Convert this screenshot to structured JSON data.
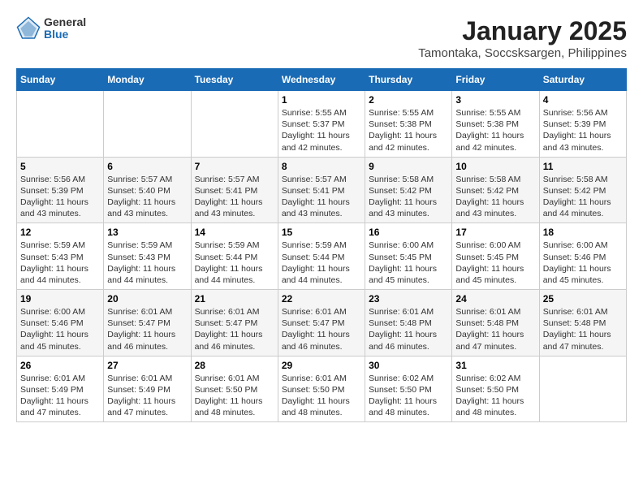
{
  "logo": {
    "general": "General",
    "blue": "Blue"
  },
  "title": "January 2025",
  "subtitle": "Tamontaka, Soccsksargen, Philippines",
  "days_of_week": [
    "Sunday",
    "Monday",
    "Tuesday",
    "Wednesday",
    "Thursday",
    "Friday",
    "Saturday"
  ],
  "weeks": [
    [
      {
        "day": "",
        "info": ""
      },
      {
        "day": "",
        "info": ""
      },
      {
        "day": "",
        "info": ""
      },
      {
        "day": "1",
        "sunrise": "5:55 AM",
        "sunset": "5:37 PM",
        "daylight": "11 hours and 42 minutes."
      },
      {
        "day": "2",
        "sunrise": "5:55 AM",
        "sunset": "5:38 PM",
        "daylight": "11 hours and 42 minutes."
      },
      {
        "day": "3",
        "sunrise": "5:55 AM",
        "sunset": "5:38 PM",
        "daylight": "11 hours and 42 minutes."
      },
      {
        "day": "4",
        "sunrise": "5:56 AM",
        "sunset": "5:39 PM",
        "daylight": "11 hours and 43 minutes."
      }
    ],
    [
      {
        "day": "5",
        "sunrise": "5:56 AM",
        "sunset": "5:39 PM",
        "daylight": "11 hours and 43 minutes."
      },
      {
        "day": "6",
        "sunrise": "5:57 AM",
        "sunset": "5:40 PM",
        "daylight": "11 hours and 43 minutes."
      },
      {
        "day": "7",
        "sunrise": "5:57 AM",
        "sunset": "5:41 PM",
        "daylight": "11 hours and 43 minutes."
      },
      {
        "day": "8",
        "sunrise": "5:57 AM",
        "sunset": "5:41 PM",
        "daylight": "11 hours and 43 minutes."
      },
      {
        "day": "9",
        "sunrise": "5:58 AM",
        "sunset": "5:42 PM",
        "daylight": "11 hours and 43 minutes."
      },
      {
        "day": "10",
        "sunrise": "5:58 AM",
        "sunset": "5:42 PM",
        "daylight": "11 hours and 43 minutes."
      },
      {
        "day": "11",
        "sunrise": "5:58 AM",
        "sunset": "5:42 PM",
        "daylight": "11 hours and 44 minutes."
      }
    ],
    [
      {
        "day": "12",
        "sunrise": "5:59 AM",
        "sunset": "5:43 PM",
        "daylight": "11 hours and 44 minutes."
      },
      {
        "day": "13",
        "sunrise": "5:59 AM",
        "sunset": "5:43 PM",
        "daylight": "11 hours and 44 minutes."
      },
      {
        "day": "14",
        "sunrise": "5:59 AM",
        "sunset": "5:44 PM",
        "daylight": "11 hours and 44 minutes."
      },
      {
        "day": "15",
        "sunrise": "5:59 AM",
        "sunset": "5:44 PM",
        "daylight": "11 hours and 44 minutes."
      },
      {
        "day": "16",
        "sunrise": "6:00 AM",
        "sunset": "5:45 PM",
        "daylight": "11 hours and 45 minutes."
      },
      {
        "day": "17",
        "sunrise": "6:00 AM",
        "sunset": "5:45 PM",
        "daylight": "11 hours and 45 minutes."
      },
      {
        "day": "18",
        "sunrise": "6:00 AM",
        "sunset": "5:46 PM",
        "daylight": "11 hours and 45 minutes."
      }
    ],
    [
      {
        "day": "19",
        "sunrise": "6:00 AM",
        "sunset": "5:46 PM",
        "daylight": "11 hours and 45 minutes."
      },
      {
        "day": "20",
        "sunrise": "6:01 AM",
        "sunset": "5:47 PM",
        "daylight": "11 hours and 46 minutes."
      },
      {
        "day": "21",
        "sunrise": "6:01 AM",
        "sunset": "5:47 PM",
        "daylight": "11 hours and 46 minutes."
      },
      {
        "day": "22",
        "sunrise": "6:01 AM",
        "sunset": "5:47 PM",
        "daylight": "11 hours and 46 minutes."
      },
      {
        "day": "23",
        "sunrise": "6:01 AM",
        "sunset": "5:48 PM",
        "daylight": "11 hours and 46 minutes."
      },
      {
        "day": "24",
        "sunrise": "6:01 AM",
        "sunset": "5:48 PM",
        "daylight": "11 hours and 47 minutes."
      },
      {
        "day": "25",
        "sunrise": "6:01 AM",
        "sunset": "5:48 PM",
        "daylight": "11 hours and 47 minutes."
      }
    ],
    [
      {
        "day": "26",
        "sunrise": "6:01 AM",
        "sunset": "5:49 PM",
        "daylight": "11 hours and 47 minutes."
      },
      {
        "day": "27",
        "sunrise": "6:01 AM",
        "sunset": "5:49 PM",
        "daylight": "11 hours and 47 minutes."
      },
      {
        "day": "28",
        "sunrise": "6:01 AM",
        "sunset": "5:50 PM",
        "daylight": "11 hours and 48 minutes."
      },
      {
        "day": "29",
        "sunrise": "6:01 AM",
        "sunset": "5:50 PM",
        "daylight": "11 hours and 48 minutes."
      },
      {
        "day": "30",
        "sunrise": "6:02 AM",
        "sunset": "5:50 PM",
        "daylight": "11 hours and 48 minutes."
      },
      {
        "day": "31",
        "sunrise": "6:02 AM",
        "sunset": "5:50 PM",
        "daylight": "11 hours and 48 minutes."
      },
      {
        "day": "",
        "info": ""
      }
    ]
  ]
}
